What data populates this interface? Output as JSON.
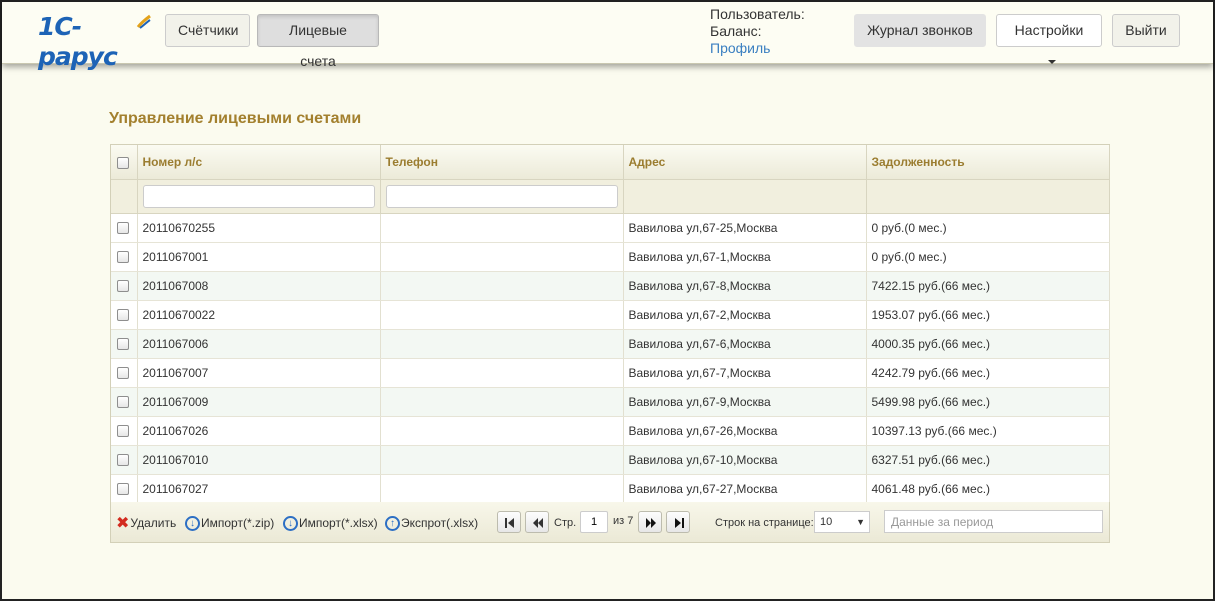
{
  "header": {
    "logo_text": "1С-рарус",
    "nav": {
      "meters": "Счётчики",
      "accounts": "Лицевые счета"
    },
    "user_label": "Пользователь:",
    "balance_label": "Баланс:",
    "profile_link": "Профиль",
    "call_log": "Журнал звонков",
    "settings": "Настройки",
    "logout": "Выйти"
  },
  "page_title": "Управление лицевыми счетами",
  "table": {
    "columns": [
      "Номер л/с",
      "Телефон",
      "Адрес",
      "Задолженность"
    ],
    "rows": [
      {
        "account": "20110670255",
        "phone": "",
        "address": "Вавилова ул,67-25,Москва",
        "debt": "0 руб.(0 мес.)"
      },
      {
        "account": "2011067001",
        "phone": "",
        "address": "Вавилова ул,67-1,Москва",
        "debt": "0 руб.(0 мес.)"
      },
      {
        "account": "2011067008",
        "phone": "",
        "address": "Вавилова ул,67-8,Москва",
        "debt": "7422.15 руб.(66 мес.)"
      },
      {
        "account": "20110670022",
        "phone": "",
        "address": "Вавилова ул,67-2,Москва",
        "debt": "1953.07 руб.(66 мес.)"
      },
      {
        "account": "2011067006",
        "phone": "",
        "address": "Вавилова ул,67-6,Москва",
        "debt": "4000.35 руб.(66 мес.)"
      },
      {
        "account": "2011067007",
        "phone": "",
        "address": "Вавилова ул,67-7,Москва",
        "debt": "4242.79 руб.(66 мес.)"
      },
      {
        "account": "2011067009",
        "phone": "",
        "address": "Вавилова ул,67-9,Москва",
        "debt": "5499.98 руб.(66 мес.)"
      },
      {
        "account": "2011067026",
        "phone": "",
        "address": "Вавилова ул,67-26,Москва",
        "debt": "10397.13 руб.(66 мес.)"
      },
      {
        "account": "2011067010",
        "phone": "",
        "address": "Вавилова ул,67-10,Москва",
        "debt": "6327.51 руб.(66 мес.)"
      },
      {
        "account": "2011067027",
        "phone": "",
        "address": "Вавилова ул,67-27,Москва",
        "debt": "4061.48 руб.(66 мес.)"
      }
    ]
  },
  "pager": {
    "delete": "Удалить",
    "import_zip": "Импорт(*.zip)",
    "import_xlsx": "Импорт(*.xlsx)",
    "export_xlsx": "Экспрот(.xlsx)",
    "page_label": "Стр.",
    "page_value": "1",
    "of_label": "из 7",
    "rows_label": "Строк на странице:",
    "rows_value": "10",
    "period_placeholder": "Данные за период"
  },
  "colors": {
    "title": "#a3802e",
    "link": "#3a7fc1",
    "logo": "#1d63b6"
  }
}
